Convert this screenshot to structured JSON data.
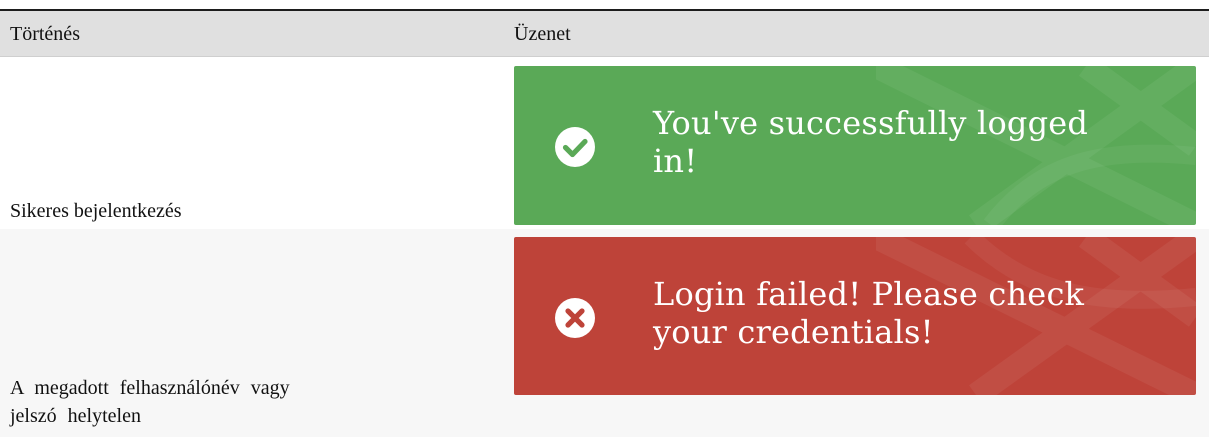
{
  "table": {
    "headers": {
      "event": "Történés",
      "message": "Üzenet"
    },
    "rows": [
      {
        "event": "Sikeres bejelentkezés",
        "message": {
          "type": "success",
          "icon": "check-circle-icon",
          "text": "You've successfully logged in!",
          "color": "#5aa957"
        }
      },
      {
        "event": "A megadott felhasználónév vagy jelszó helytelen",
        "message": {
          "type": "error",
          "icon": "x-circle-icon",
          "text": "Login failed! Please check your credentials!",
          "color": "#be4339"
        }
      }
    ]
  }
}
